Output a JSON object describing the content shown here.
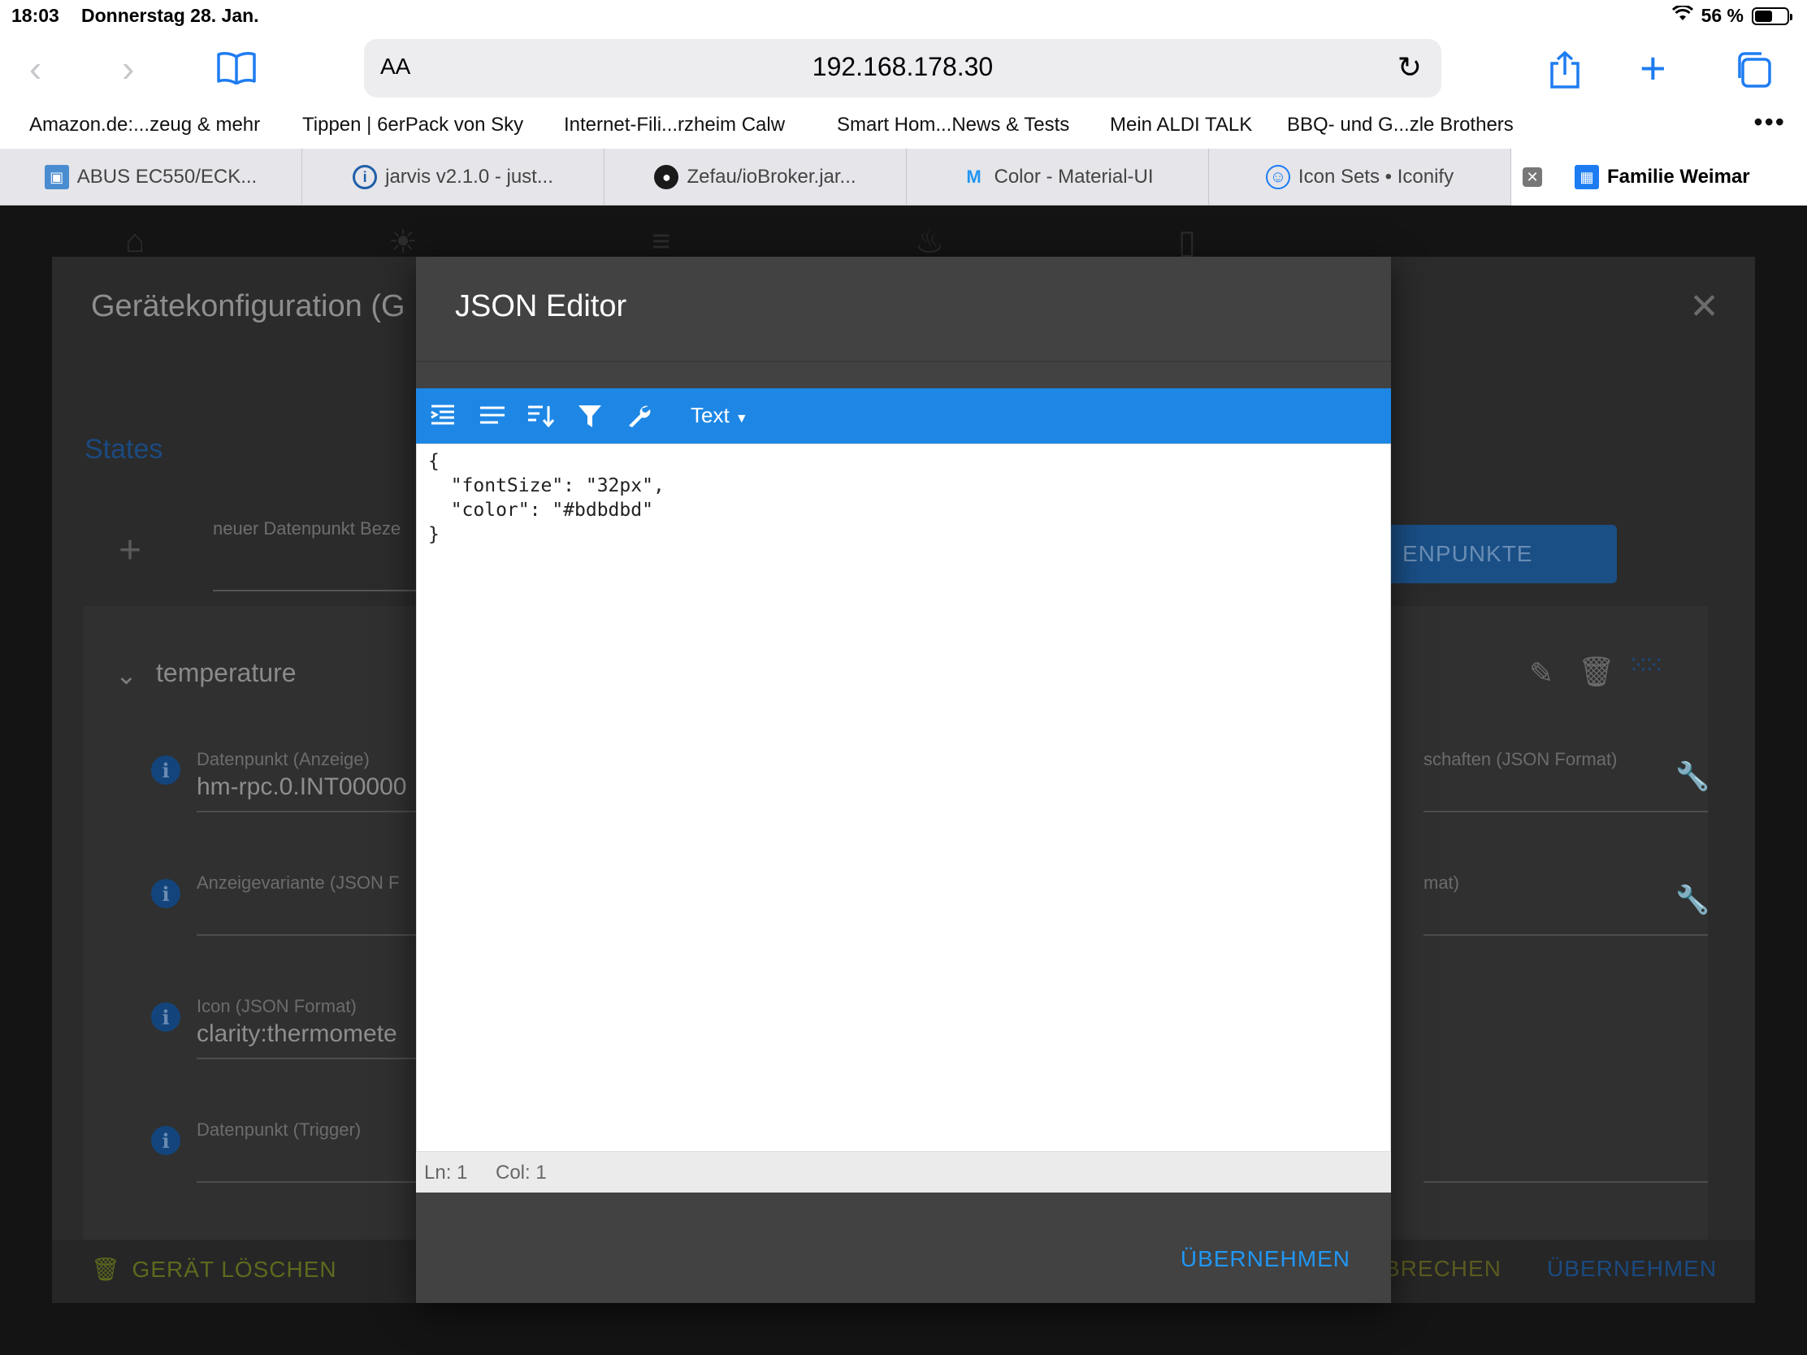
{
  "status_bar": {
    "time": "18:03",
    "date": "Donnerstag 28. Jan.",
    "battery": "56 %",
    "battery_level": 0.56
  },
  "toolbar": {
    "text_size_label": "AA",
    "url": "192.168.178.30"
  },
  "favorites": [
    "Amazon.de:...zeug & mehr",
    "Tippen | 6erPack von Sky",
    "Internet-Fili...rzheim Calw",
    "Smart Hom...News & Tests",
    "Mein ALDI TALK",
    "BBQ- und G...zle Brothers"
  ],
  "tabs": [
    {
      "label": "ABUS EC550/ECK..."
    },
    {
      "label": "jarvis v2.1.0 - just..."
    },
    {
      "label": "Zefau/ioBroker.jar..."
    },
    {
      "label": "Color - Material-UI"
    },
    {
      "label": "Icon Sets • Iconify"
    },
    {
      "label": "Familie Weimar"
    }
  ],
  "background_dialog": {
    "title": "Gerätekonfiguration (G",
    "states_tab": "States",
    "new_datapoint_label": "neuer Datenpunkt Beze",
    "datapoints_button": "ENPUNKTE",
    "card_title": "temperature",
    "fields": [
      {
        "label": "Datenpunkt (Anzeige)",
        "value": "hm-rpc.0.INT00000"
      },
      {
        "label": "Anzeigevariante (JSON F",
        "value": ""
      },
      {
        "label": "Icon (JSON Format)",
        "value": "clarity:thermomete"
      },
      {
        "label": "Datenpunkt (Trigger)",
        "value": ""
      }
    ],
    "right_labels": [
      "schaften (JSON Format)",
      "mat)"
    ],
    "delete_device": "GERÄT LÖSCHEN",
    "cancel": "BRECHEN",
    "apply": "ÜBERNEHMEN"
  },
  "json_editor": {
    "title": "JSON Editor",
    "mode": "Text",
    "content": "{\n  \"fontSize\": \"32px\",\n  \"color\": \"#bdbdbd\"\n}",
    "line_status": "Ln: 1",
    "col_status": "Col: 1",
    "apply_button": "ÜBERNEHMEN"
  },
  "colors": {
    "accent": "#1e87e5",
    "ios_blue": "#1e7cf2",
    "modal_bg": "#424242"
  }
}
